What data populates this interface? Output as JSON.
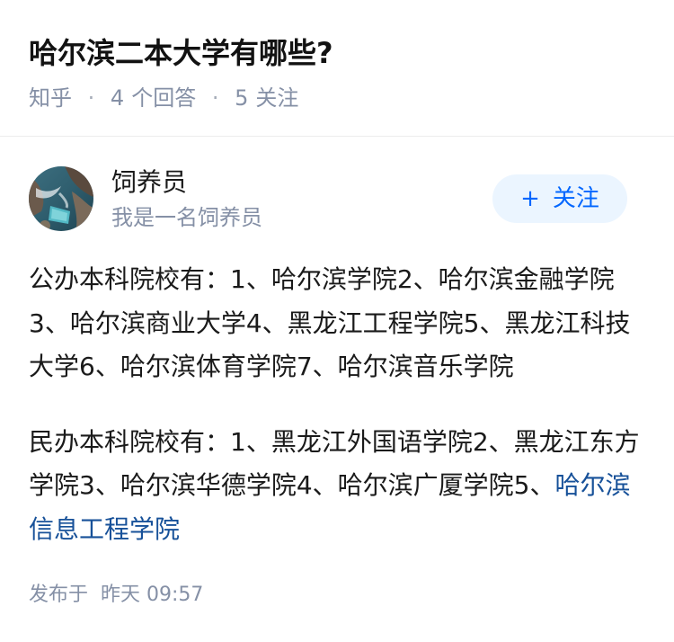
{
  "question": {
    "title": "哈尔滨二本大学有哪些?",
    "source": "知乎",
    "answer_count": "4",
    "answer_label": "个回答",
    "follower_count": "5",
    "follower_label": "关注"
  },
  "answer": {
    "author": {
      "name": "饲养员",
      "bio": "我是一名饲养员"
    },
    "follow_button": {
      "icon": "+",
      "label": "关注"
    },
    "paragraphs": [
      "公办本科院校有：1、哈尔滨学院2、哈尔滨金融学院3、哈尔滨商业大学4、黑龙江工程学院5、黑龙江科技大学6、哈尔滨体育学院7、哈尔滨音乐学院",
      "民办本科院校有：1、黑龙江外国语学院2、黑龙江东方学院3、哈尔滨华德学院4、哈尔滨广厦学院5、"
    ],
    "link_text": "哈尔滨信息工程学院",
    "published_label": "发布于",
    "published_time": "昨天 09:57"
  },
  "colors": {
    "link": "#175199",
    "accent": "#0066ff",
    "muted": "#8590a6",
    "button_bg": "#ebf5ff"
  }
}
